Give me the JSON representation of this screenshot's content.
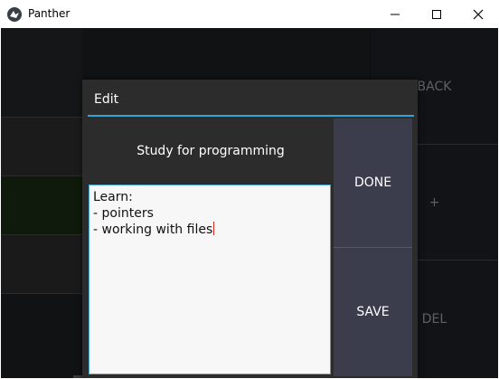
{
  "window": {
    "title": "Panther"
  },
  "background": {
    "buttons": [
      "BACK",
      "+",
      "DEL"
    ]
  },
  "dialog": {
    "title": "Edit",
    "task_title": "Study for programming",
    "notes_text": "Learn:\n- pointers\n- working with files",
    "done_label": "DONE",
    "save_label": "SAVE"
  },
  "colors": {
    "accent": "#33a4d5",
    "button_bg": "#3b3d4c",
    "dialog_bg": "#2c2c2c",
    "caret": "#d4241d"
  }
}
